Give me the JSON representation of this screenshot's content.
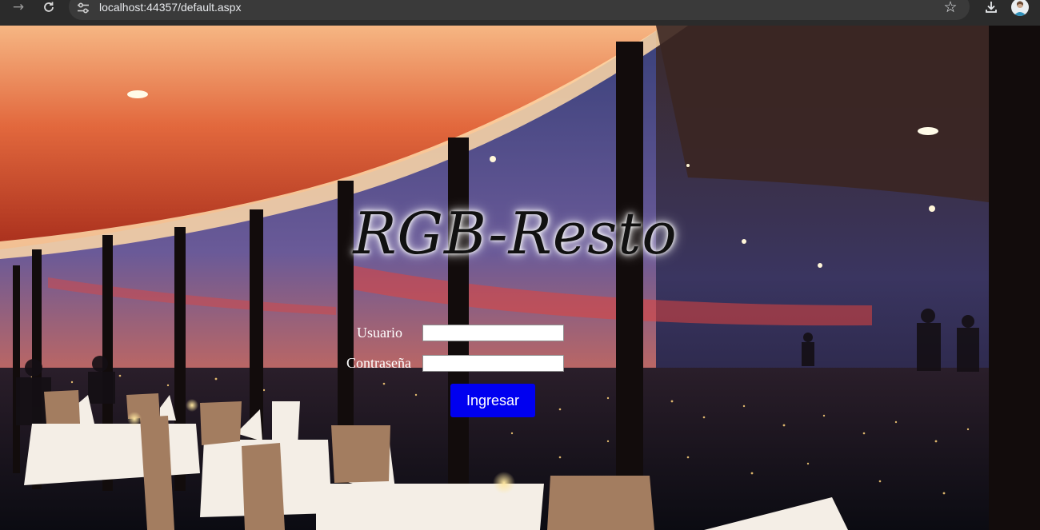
{
  "browser": {
    "url": "localhost:44357/default.aspx",
    "icons": [
      "arrow-forward",
      "reload",
      "site-settings",
      "bookmark-star",
      "download",
      "profile-avatar"
    ]
  },
  "page": {
    "brand": "RGB-Resto",
    "background": "restaurant interior with city view at dusk",
    "form": {
      "username_label": "Usuario",
      "username_value": "",
      "password_label": "Contraseña",
      "password_value": "",
      "submit_label": "Ingresar"
    }
  },
  "colors": {
    "submit_button": "#0000f0",
    "label_text": "#ffffff",
    "chrome_bg": "#2b2b2b"
  }
}
